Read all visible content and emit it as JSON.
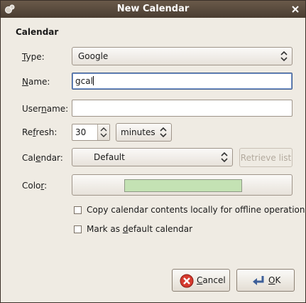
{
  "window": {
    "title": "New Calendar"
  },
  "section": {
    "title": "Calendar"
  },
  "fields": {
    "type": {
      "label_pre": "",
      "label_mn": "T",
      "label_post": "ype:",
      "value": "Google"
    },
    "name": {
      "label_pre": "",
      "label_mn": "N",
      "label_post": "ame:",
      "value": "gcal"
    },
    "username": {
      "label_pre": "User",
      "label_mn": "n",
      "label_post": "ame:",
      "value": ""
    },
    "refresh": {
      "label_pre": "Re",
      "label_mn": "f",
      "label_post": "resh:",
      "value": "30",
      "unit": "minutes"
    },
    "calendar": {
      "label_pre": "Cal",
      "label_mn": "e",
      "label_post": "ndar:",
      "value": "Default",
      "retrieve_label": "Retrieve list"
    },
    "color": {
      "label_pre": "Colo",
      "label_mn": "r",
      "label_post": ":",
      "swatch_color": "#c4e2b4"
    }
  },
  "options": {
    "copy_locally": {
      "label": "Copy calendar contents locally for offline operation",
      "checked": false
    },
    "default": {
      "label_pre": "Mark as ",
      "label_mn": "d",
      "label_post": "efault calendar",
      "checked": false
    }
  },
  "buttons": {
    "cancel": {
      "label_mn": "C",
      "label_post": "ancel"
    },
    "ok": {
      "label_mn": "O",
      "label_post": "K"
    }
  },
  "colors": {
    "titlebar": "#5a4b3d",
    "background": "#efebe3",
    "focus_border": "#3c5a8c"
  }
}
